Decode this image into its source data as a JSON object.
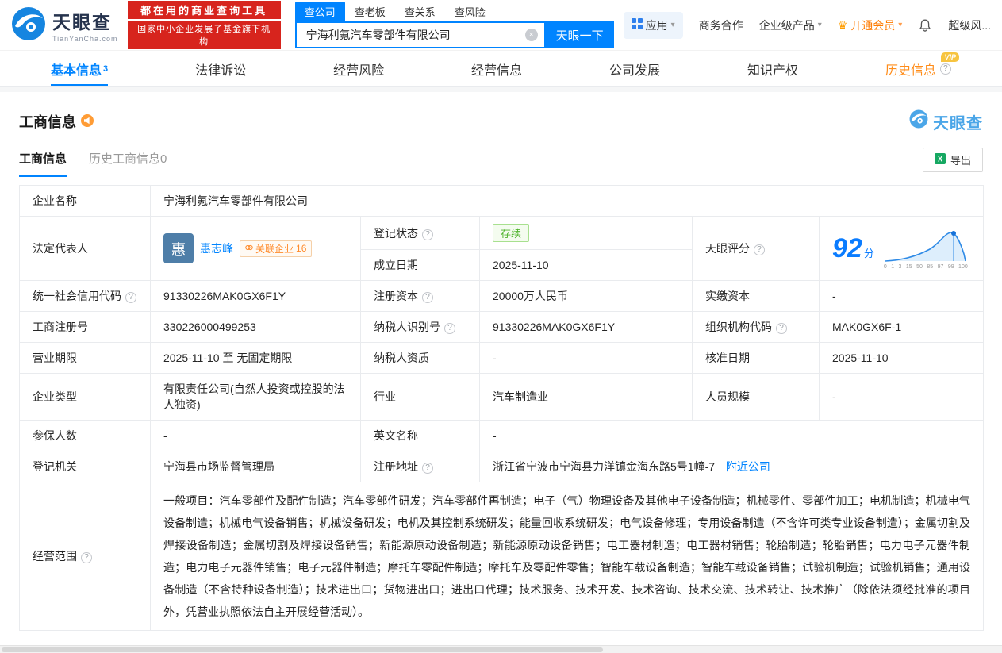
{
  "icons": {
    "help": "?",
    "caret": "▾",
    "clear": "×",
    "crown": "♛"
  },
  "header": {
    "logo_title": "天眼查",
    "logo_subtitle": "TianYanCha.com",
    "slogan_line1": "都在用的商业查询工具",
    "slogan_line2": "国家中小企业发展子基金旗下机构",
    "search_tabs": {
      "company": "查公司",
      "boss": "查老板",
      "relation": "查关系",
      "risk": "查风险"
    },
    "search_value": "宁海利氪汽车零部件有限公司",
    "search_button": "天眼一下",
    "nav": {
      "apps": "应用",
      "cooperation": "商务合作",
      "enterprise": "企业级产品",
      "vip": "开通会员",
      "super_risk": "超级风..."
    }
  },
  "main_tabs": {
    "basic": {
      "label": "基本信息",
      "count": "3"
    },
    "legal": {
      "label": "法律诉讼"
    },
    "risk": {
      "label": "经营风险"
    },
    "operation": {
      "label": "经营信息"
    },
    "development": {
      "label": "公司发展"
    },
    "ip": {
      "label": "知识产权"
    },
    "history": {
      "label": "历史信息",
      "vip": "VIP"
    }
  },
  "section": {
    "title": "工商信息",
    "watermark": "天眼查",
    "subtab_active": "工商信息",
    "subtab_history": "历史工商信息0",
    "export": "导出"
  },
  "info": {
    "company_name": {
      "label": "企业名称",
      "value": "宁海利氪汽车零部件有限公司"
    },
    "legal_rep": {
      "label": "法定代表人",
      "avatar": "惠",
      "name": "惠志峰",
      "related_label": "关联企业",
      "related_count": "16"
    },
    "reg_status": {
      "label": "登记状态",
      "value": "存续"
    },
    "establish_date": {
      "label": "成立日期",
      "value": "2025-11-10"
    },
    "score": {
      "label": "天眼评分",
      "value": "92",
      "unit": "分",
      "ticks": [
        "0",
        "1",
        "3",
        "15",
        "50",
        "85",
        "97",
        "99",
        "100"
      ]
    },
    "credit_code": {
      "label": "统一社会信用代码",
      "value": "91330226MAK0GX6F1Y"
    },
    "reg_capital": {
      "label": "注册资本",
      "value": "20000万人民币"
    },
    "paid_capital": {
      "label": "实缴资本",
      "value": "-"
    },
    "reg_no": {
      "label": "工商注册号",
      "value": "330226000499253"
    },
    "taxpayer_no": {
      "label": "纳税人识别号",
      "value": "91330226MAK0GX6F1Y"
    },
    "org_code": {
      "label": "组织机构代码",
      "value": "MAK0GX6F-1"
    },
    "business_term": {
      "label": "营业期限",
      "value": "2025-11-10 至 无固定期限"
    },
    "taxpayer_quality": {
      "label": "纳税人资质",
      "value": "-"
    },
    "approve_date": {
      "label": "核准日期",
      "value": "2025-11-10"
    },
    "company_type": {
      "label": "企业类型",
      "value": "有限责任公司(自然人投资或控股的法人独资)"
    },
    "industry": {
      "label": "行业",
      "value": "汽车制造业"
    },
    "staff_size": {
      "label": "人员规模",
      "value": "-"
    },
    "insured_num": {
      "label": "参保人数",
      "value": "-"
    },
    "english_name": {
      "label": "英文名称",
      "value": "-"
    },
    "reg_authority": {
      "label": "登记机关",
      "value": "宁海县市场监督管理局"
    },
    "reg_address": {
      "label": "注册地址",
      "value": "浙江省宁波市宁海县力洋镇金海东路5号1幢-7",
      "nearby": "附近公司"
    },
    "business_scope": {
      "label": "经营范围",
      "value": "一般项目：汽车零部件及配件制造；汽车零部件研发；汽车零部件再制造；电子（气）物理设备及其他电子设备制造；机械零件、零部件加工；电机制造；机械电气设备制造；机械电气设备销售；机械设备研发；电机及其控制系统研发；能量回收系统研发；电气设备修理；专用设备制造（不含许可类专业设备制造）；金属切割及焊接设备制造；金属切割及焊接设备销售；新能源原动设备制造；新能源原动设备销售；电工器材制造；电工器材销售；轮胎制造；轮胎销售；电力电子元器件制造；电力电子元器件销售；电子元器件制造；摩托车零配件制造；摩托车及零配件零售；智能车载设备制造；智能车载设备销售；试验机制造；试验机销售；通用设备制造（不含特种设备制造）；技术进出口；货物进出口；进出口代理；技术服务、技术开发、技术咨询、技术交流、技术转让、技术推广（除依法须经批准的项目外，凭营业执照依法自主开展经营活动）。"
    }
  }
}
